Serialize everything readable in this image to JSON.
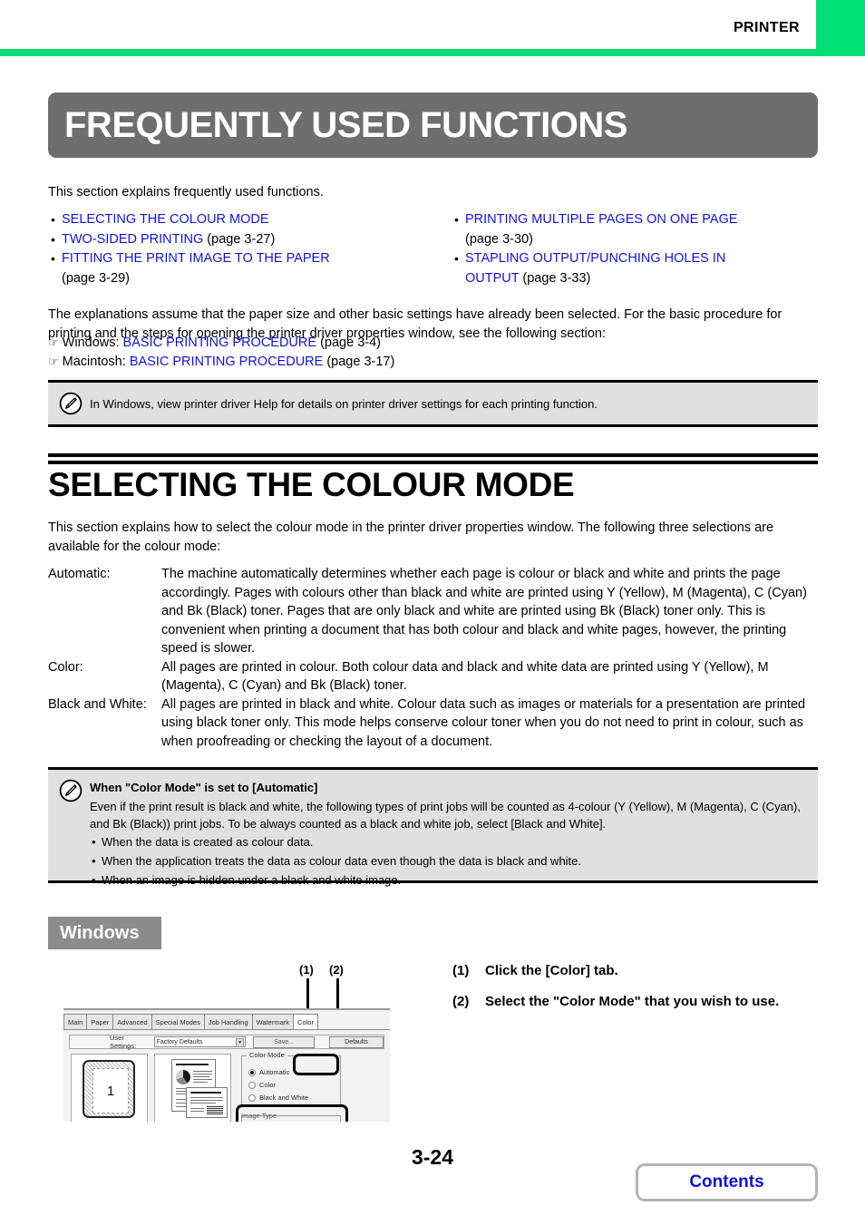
{
  "header": {
    "title": "PRINTER",
    "green": "#00DE76"
  },
  "banner": {
    "title": "FREQUENTLY USED FUNCTIONS"
  },
  "intro": {
    "text": "This section explains frequently used functions."
  },
  "links": {
    "left": [
      {
        "link": "SELECTING THE COLOUR MODE",
        "page": ""
      },
      {
        "link": "TWO-SIDED PRINTING",
        "page": " (page 3-27)"
      },
      {
        "link": "FITTING THE PRINT IMAGE TO THE PAPER",
        "page": "",
        "cont": "(page 3-29)"
      }
    ],
    "right": [
      {
        "link": "PRINTING MULTIPLE PAGES ON ONE PAGE",
        "page": "",
        "cont": "(page 3-30)"
      },
      {
        "link": "STAPLING OUTPUT/PUNCHING HOLES IN",
        "page": "",
        "cont_link": "OUTPUT",
        "cont": " (page 3-33)"
      }
    ]
  },
  "assume": {
    "text": "The explanations assume that the paper size and other basic settings have already been selected. For the basic procedure for printing and the steps for opening the printer driver properties window, see the following section:",
    "ref1_prefix": "Windows: ",
    "ref1_link": "BASIC PRINTING PROCEDURE",
    "ref1_page": " (page 3-4)",
    "ref2_prefix": "Macintosh: ",
    "ref2_link": "BASIC PRINTING PROCEDURE",
    "ref2_page": " (page 3-17)"
  },
  "note1": {
    "text": "In Windows, view printer driver Help for details on printer driver settings for each printing function."
  },
  "section": {
    "heading": "SELECTING THE COLOUR MODE",
    "intro": "This section explains how to select the colour mode in the printer driver properties window. The following three selections are available for the colour mode:"
  },
  "definitions": [
    {
      "term": "Automatic:",
      "desc": "The machine automatically determines whether each page is colour or black and white and prints the page accordingly. Pages with colours other than black and white are printed using Y (Yellow), M (Magenta), C (Cyan) and Bk (Black) toner. Pages that are only black and white are printed using Bk (Black) toner only. This is convenient when printing a document that has both colour and black and white pages, however, the printing speed is slower."
    },
    {
      "term": "Color:",
      "desc": "All pages are printed in colour. Both colour data and black and white data are printed using Y (Yellow), M (Magenta), C (Cyan) and Bk (Black) toner."
    },
    {
      "term": "Black and White:",
      "desc": "All pages are printed in black and white. Colour data such as images or materials for a presentation are printed using black toner only. This mode helps conserve colour toner when you do not need to print in colour, such as when proofreading or checking the layout of a document."
    }
  ],
  "note2": {
    "title": "When \"Color Mode\" is set to [Automatic]",
    "body": "Even if the print result is black and white, the following types of print jobs will be counted as 4-colour (Y (Yellow), M (Magenta), C (Cyan), and Bk (Black)) print jobs. To be always counted as a black and white job, select [Black and White].",
    "bullets": [
      "When the data is created as colour data.",
      "When the application treats the data as colour data even though the data is black and white.",
      "When an image is hidden under a black and white image."
    ]
  },
  "windows_badge": {
    "label": "Windows"
  },
  "figure": {
    "callouts": [
      "(1)",
      "(2)"
    ],
    "tabs": [
      "Main",
      "Paper",
      "Advanced",
      "Special Modes",
      "Job Handling",
      "Watermark",
      "Color"
    ],
    "selected_tab": "Color",
    "user_settings_label": "User Settings:",
    "user_settings_value": "Factory Defaults",
    "save_button": "Save...",
    "defaults_button": "Defaults",
    "preview_page_number": "1",
    "color_mode_legend": "Color Mode",
    "color_mode_options": [
      "Automatic",
      "Color",
      "Black and White"
    ],
    "color_mode_selected": "Automatic",
    "image_type_legend": "Image Type"
  },
  "steps": [
    {
      "num": "(1)",
      "text": "Click the [Color] tab."
    },
    {
      "num": "(2)",
      "text": "Select the \"Color Mode\" that you wish to use."
    }
  ],
  "footer": {
    "page_number": "3-24",
    "contents_label": "Contents"
  }
}
